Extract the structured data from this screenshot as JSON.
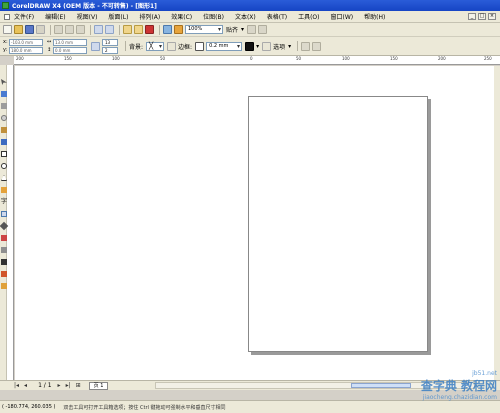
{
  "window": {
    "title": "CorelDRAW X4 (OEM 版本 - 不可转售) - [图形1]"
  },
  "menu": [
    "文件(F)",
    "编辑(E)",
    "视图(V)",
    "版面(L)",
    "排列(A)",
    "效果(C)",
    "位图(B)",
    "文本(X)",
    "表格(T)",
    "工具(O)",
    "窗口(W)",
    "帮助(H)"
  ],
  "toolbar": {
    "zoom_value": "100%",
    "snap_label": "贴齐",
    "snap_arrow": "▾"
  },
  "propertybar": {
    "x_label": "x:",
    "x_value": "-103.0 mm",
    "y_label": "y:",
    "y_value": "180.0 mm",
    "w_label": "↔",
    "w_value": "13.0 mm",
    "h_label": "↕",
    "h_value": "0.0 mm",
    "spin1": "13",
    "spin2": "2",
    "bg_label": "背景:",
    "border_label": "边框:",
    "border_width": "0.2 mm",
    "options_label": "选项"
  },
  "ruler_ticks": [
    "200",
    "150",
    "100",
    "50",
    "0",
    "50",
    "100",
    "150",
    "200",
    "250"
  ],
  "pager": {
    "first": "|◂",
    "prev": "◂",
    "count": "1 / 1",
    "next": "▸",
    "last": "▸|",
    "add": "⊞",
    "page_tab": "页 1"
  },
  "status": {
    "coords": "( -180.774, 260.035 )",
    "hint": "双击工具可打开工具箱选项；按住 Ctrl 键拖动可强制水平和垂直尺寸相同"
  },
  "watermark": {
    "line1": "查字典 教程网",
    "line2": "jiaocheng.chazidian.com",
    "site": "jb51.net"
  },
  "colors": {
    "titlebar": "#1645c4",
    "chrome": "#ece9d8",
    "page_border": "#888888"
  }
}
